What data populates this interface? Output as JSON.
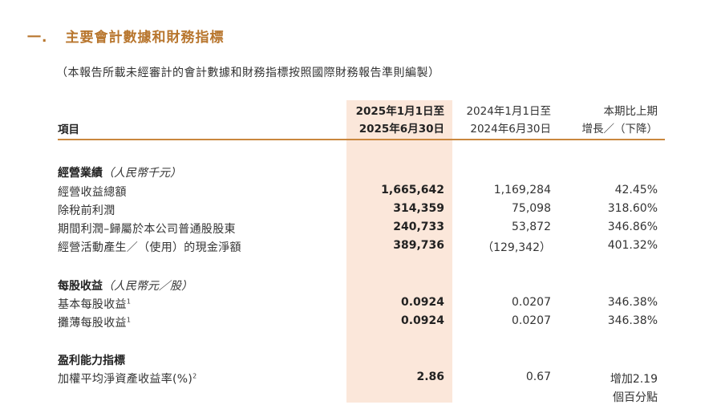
{
  "section": {
    "number": "一.",
    "title": "主要會計數據和財務指標"
  },
  "note": "（本報告所載未經審計的會計數據和財務指標按照國際財務報告準則編製）",
  "header": {
    "item_col": "項目",
    "current": [
      "2025年1月1日至",
      "2025年6月30日"
    ],
    "prior": [
      "2024年1月1日至",
      "2024年6月30日"
    ],
    "change": [
      "本期比上期",
      "增長／（下降）"
    ]
  },
  "groups": [
    {
      "title": "經營業績",
      "unit": "（人民幣千元）",
      "rows": [
        {
          "label": "經營收益總額",
          "current": "1,665,642",
          "prior": "1,169,284",
          "change": "42.45%"
        },
        {
          "label": "除稅前利潤",
          "current": "314,359",
          "prior": "75,098",
          "change": "318.60%"
        },
        {
          "label": "期間利潤–歸屬於本公司普通股股東",
          "current": "240,733",
          "prior": "53,872",
          "change": "346.86%"
        },
        {
          "label": "經營活動產生／（使用）的現金淨額",
          "current": "389,736",
          "prior": "（129,342）",
          "change": "401.32%"
        }
      ]
    },
    {
      "title": "每股收益",
      "unit": "（人民幣元／股）",
      "rows": [
        {
          "label": "基本每股收益",
          "sup": "1",
          "current": "0.0924",
          "prior": "0.0207",
          "change": "346.38%"
        },
        {
          "label": "攤薄每股收益",
          "sup": "1",
          "current": "0.0924",
          "prior": "0.0207",
          "change": "346.38%"
        }
      ]
    },
    {
      "title": "盈利能力指標",
      "rows": [
        {
          "label": "加權平均淨資產收益率(%)",
          "sup": "2",
          "current": "2.86",
          "prior": "0.67",
          "change": "增加2.19",
          "change2": "個百分點"
        }
      ]
    }
  ]
}
